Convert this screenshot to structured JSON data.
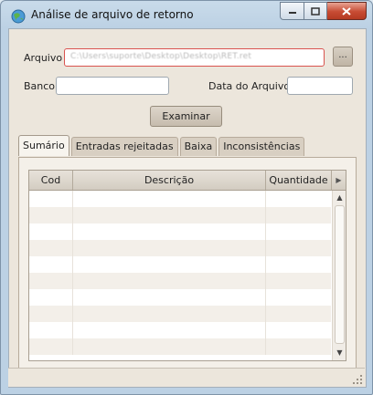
{
  "window": {
    "title": "Análise de arquivo de retorno"
  },
  "form": {
    "arquivo_label": "Arquivo",
    "arquivo_value": "C:\\Users\\suporte\\Desktop\\Desktop\\RET.ret",
    "browse_label": "...",
    "banco_label": "Banco",
    "banco_value": "",
    "data_label": "Data do Arquivo",
    "data_value": "",
    "examinar_label": "Examinar"
  },
  "tabs": [
    {
      "label": "Sumário",
      "active": true
    },
    {
      "label": "Entradas rejeitadas",
      "active": false
    },
    {
      "label": "Baixa",
      "active": false
    },
    {
      "label": "Inconsistências",
      "active": false
    }
  ],
  "table": {
    "columns": [
      "Cod",
      "Descrição",
      "Quantidade"
    ],
    "rows": []
  },
  "colors": {
    "accent_border": "#d9534f",
    "panel_bg": "#ece6dc"
  }
}
